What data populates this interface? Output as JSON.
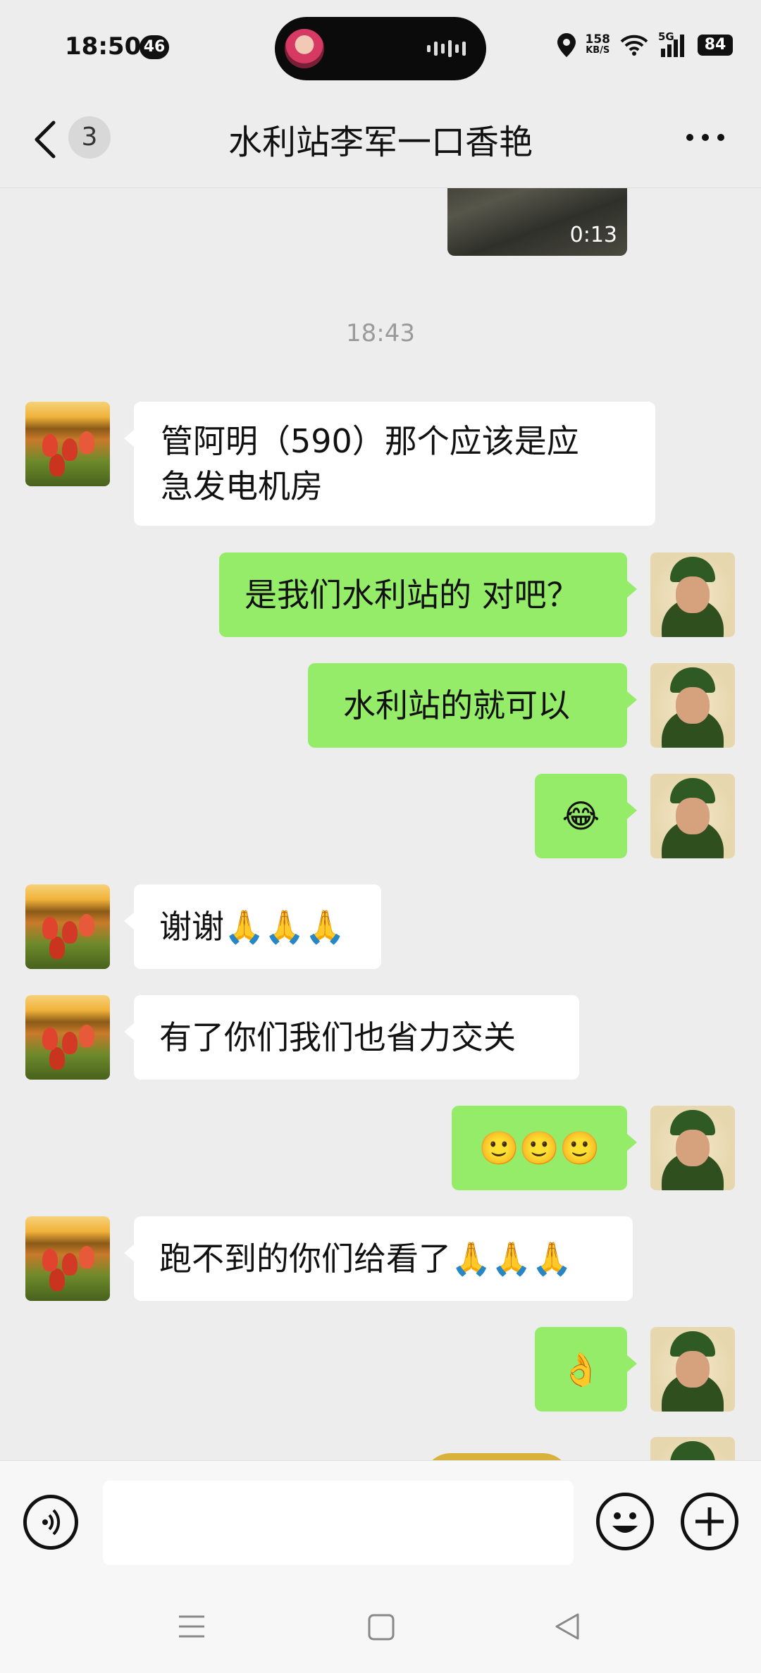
{
  "status_bar": {
    "time": "18:50",
    "notif_count": "46",
    "net_speed": "158",
    "net_unit": "KB/S",
    "signal_label": "5G",
    "battery": "84"
  },
  "header": {
    "unread_count": "3",
    "title": "水利站李军一口香艳"
  },
  "video": {
    "duration": "0:13"
  },
  "timestamp": "18:43",
  "messages": [
    {
      "side": "left",
      "text": "管阿明（590）那个应该是应\n急发电机房"
    },
    {
      "side": "right",
      "text": "是我们水利站的 对吧？"
    },
    {
      "side": "right",
      "text": "水利站的就可以"
    },
    {
      "side": "right",
      "text": "😂"
    },
    {
      "side": "left",
      "text": "谢谢🙏🙏🙏"
    },
    {
      "side": "left",
      "text": "有了你们我们也省力交关"
    },
    {
      "side": "right",
      "text": "🙂🙂🙂"
    },
    {
      "side": "left",
      "text": "跑不到的你们给看了🙏🙏🙏"
    },
    {
      "side": "right",
      "text": "👌"
    }
  ],
  "colors": {
    "bg": "#EDEDED",
    "bubble_self": "#95EC69",
    "bubble_other": "#FFFFFF"
  },
  "icons": {
    "back": "chevron-left-icon",
    "more": "more-dots-icon",
    "voice": "voice-icon",
    "emoji": "emoji-icon",
    "plus": "plus-icon",
    "nav_menu": "menu-icon",
    "nav_home": "home-icon",
    "nav_back": "back-triangle-icon"
  }
}
